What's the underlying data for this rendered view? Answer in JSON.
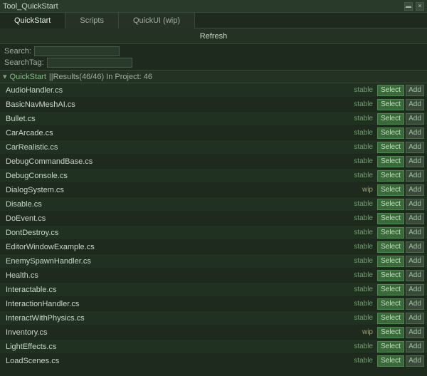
{
  "titleBar": {
    "title": "Tool_QuickStart",
    "controls": [
      "collapse",
      "close"
    ]
  },
  "tabs": [
    {
      "label": "QuickStart",
      "active": true
    },
    {
      "label": "Scripts",
      "active": false
    },
    {
      "label": "QuickUI (wip)",
      "active": false
    }
  ],
  "refreshButton": "Refresh",
  "search": {
    "searchLabel": "Search:",
    "searchTagLabel": "SearchTag:",
    "searchValue": "",
    "searchTagValue": ""
  },
  "results": {
    "triangle": "▾",
    "sectionName": "QuickStart",
    "separator": "||",
    "text": "Results(46/46) In Project: 46"
  },
  "items": [
    {
      "name": "AudioHandler.cs",
      "status": "stable",
      "statusClass": ""
    },
    {
      "name": "BasicNavMeshAI.cs",
      "status": "stable",
      "statusClass": ""
    },
    {
      "name": "Bullet.cs",
      "status": "stable",
      "statusClass": ""
    },
    {
      "name": "CarArcade.cs",
      "status": "stable",
      "statusClass": ""
    },
    {
      "name": "CarRealistic.cs",
      "status": "stable",
      "statusClass": ""
    },
    {
      "name": "DebugCommandBase.cs",
      "status": "stable",
      "statusClass": ""
    },
    {
      "name": "DebugConsole.cs",
      "status": "stable",
      "statusClass": ""
    },
    {
      "name": "DialogSystem.cs",
      "status": "wip",
      "statusClass": "wip"
    },
    {
      "name": "Disable.cs",
      "status": "stable",
      "statusClass": ""
    },
    {
      "name": "DoEvent.cs",
      "status": "stable",
      "statusClass": ""
    },
    {
      "name": "DontDestroy.cs",
      "status": "stable",
      "statusClass": ""
    },
    {
      "name": "EditorWindowExample.cs",
      "status": "stable",
      "statusClass": ""
    },
    {
      "name": "EnemySpawnHandler.cs",
      "status": "stable",
      "statusClass": ""
    },
    {
      "name": "Health.cs",
      "status": "stable",
      "statusClass": ""
    },
    {
      "name": "Interactable.cs",
      "status": "stable",
      "statusClass": ""
    },
    {
      "name": "InteractionHandler.cs",
      "status": "stable",
      "statusClass": ""
    },
    {
      "name": "InteractWithPhysics.cs",
      "status": "stable",
      "statusClass": ""
    },
    {
      "name": "Inventory.cs",
      "status": "wip",
      "statusClass": "wip"
    },
    {
      "name": "LightEffects.cs",
      "status": "stable",
      "statusClass": ""
    },
    {
      "name": "LoadScenes.cs",
      "status": "stable",
      "statusClass": ""
    }
  ],
  "buttons": {
    "select": "Select",
    "add": "Add"
  }
}
